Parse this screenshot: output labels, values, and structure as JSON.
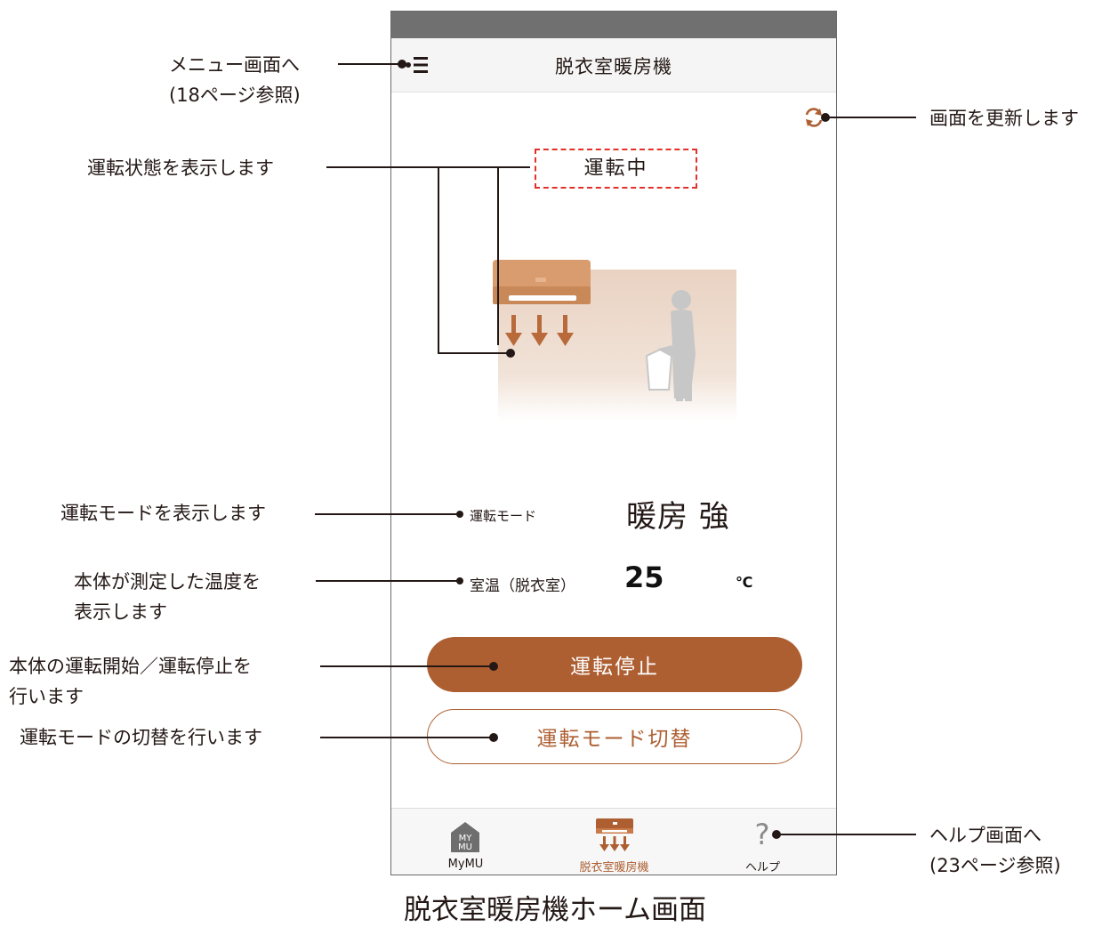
{
  "app": {
    "title": "脱衣室暖房機",
    "status_text": "運転中",
    "mode_label": "運転モード",
    "mode_value": "暖房 強",
    "temp_label": "室温（脱衣室）",
    "temp_value": "25",
    "temp_unit": "℃",
    "stop_button": "運転停止",
    "mode_switch_button": "運転モード切替",
    "tabs": [
      {
        "label": "MyMU",
        "icon": "mymu-house-icon"
      },
      {
        "label": "脱衣室暖房機",
        "icon": "heater-icon",
        "active": true
      },
      {
        "label": "ヘルプ",
        "icon": "help-question-icon"
      }
    ]
  },
  "callouts": {
    "menu": [
      "メニュー画面へ",
      "(18ページ参照)"
    ],
    "refresh": "画面を更新します",
    "status": "運転状態を表示します",
    "mode": "運転モードを表示します",
    "temperature": [
      "本体が測定した温度を",
      "表示します"
    ],
    "start_stop": [
      "本体の運転開始／運転停止を",
      "行います"
    ],
    "mode_switch": "運転モードの切替を行います",
    "help": [
      "ヘルプ画面へ",
      "(23ページ参照)"
    ]
  },
  "caption": "脱衣室暖房機ホーム画面",
  "colors": {
    "accent": "#ad5f32",
    "status_border": "#e2312b",
    "heater_body": "#d99c6e"
  }
}
